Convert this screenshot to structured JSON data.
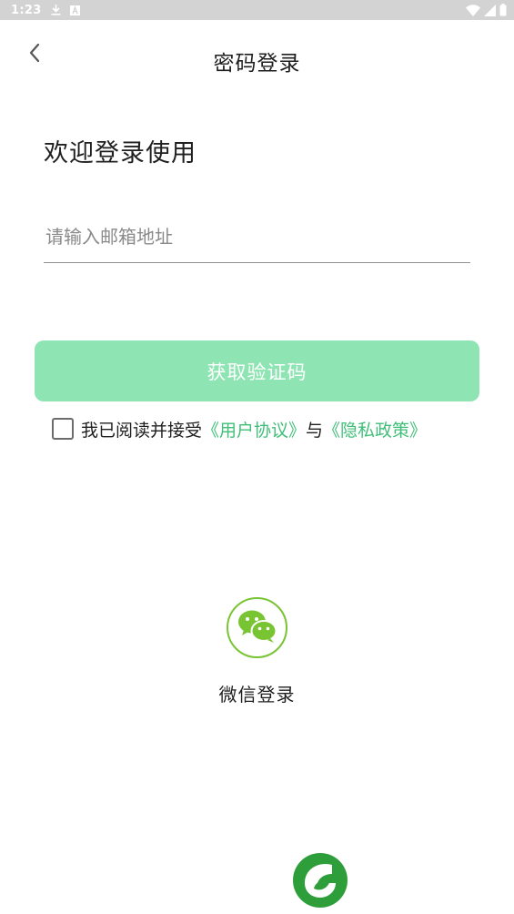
{
  "status_bar": {
    "time": "1:23",
    "icons": [
      "download-icon",
      "a11y-icon",
      "wifi-icon",
      "signal-icon",
      "battery-icon"
    ]
  },
  "header": {
    "back_icon": "chevron-left-icon",
    "title": "密码登录"
  },
  "welcome_text": "欢迎登录使用",
  "email": {
    "value": "",
    "placeholder": "请输入邮箱地址"
  },
  "get_code_button": {
    "label": "获取验证码"
  },
  "agreement": {
    "checked": false,
    "prefix": "我已阅读并接受",
    "user_agreement": "《用户协议》",
    "connector": "与",
    "privacy_policy": "《隐私政策》"
  },
  "wechat_login": {
    "icon": "wechat-icon",
    "label": "微信登录"
  },
  "app_logo": {
    "icon": "leaf-logo-icon"
  },
  "colors": {
    "accent_green": "#3fbf78",
    "button_green": "#8ee5b3",
    "wechat_green": "#79c433",
    "logo_green": "#2e9e3a",
    "status_bar_bg": "#d3d3d3"
  }
}
